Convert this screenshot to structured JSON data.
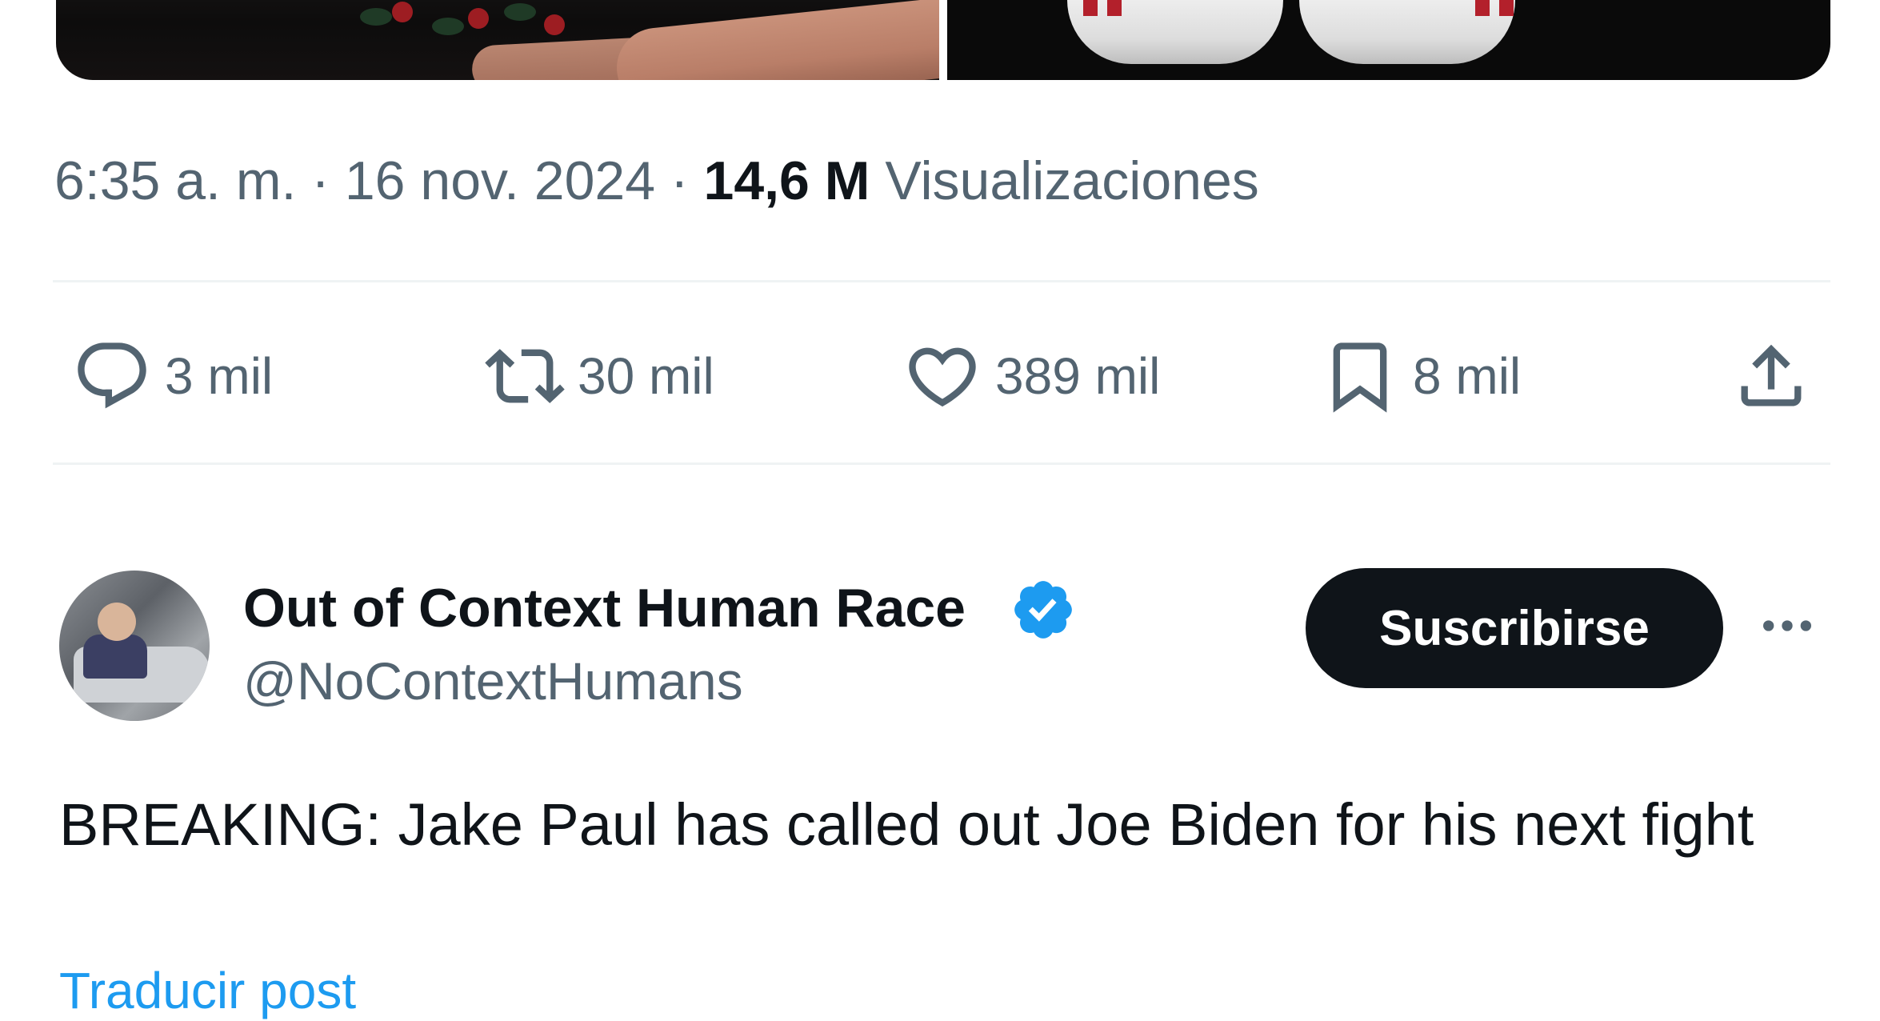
{
  "media": {
    "left_image": "image-photo-hands",
    "right_image": "image-photo-gloves"
  },
  "meta": {
    "time": "6:35 a. m.",
    "separator": "·",
    "date": "16 nov. 2024",
    "views_count": "14,6 M",
    "views_label": "Visualizaciones"
  },
  "actions": {
    "replies": {
      "icon": "reply-icon",
      "count": "3 mil"
    },
    "reposts": {
      "icon": "repost-icon",
      "count": "30 mil"
    },
    "likes": {
      "icon": "heart-icon",
      "count": "389 mil"
    },
    "bookmarks": {
      "icon": "bookmark-icon",
      "count": "8 mil"
    },
    "share": {
      "icon": "share-icon"
    }
  },
  "next_tweet": {
    "author_name": "Out of Context Human Race",
    "handle": "@NoContextHumans",
    "verified_icon": "verified-badge-icon",
    "subscribe_label": "Suscribirse",
    "more_icon": "more-options-icon",
    "text": "BREAKING: Jake Paul has called out Joe Biden for his next fight",
    "translate_label": "Traducir post"
  },
  "colors": {
    "text_primary": "#0f1419",
    "text_secondary": "#536471",
    "accent": "#1d9bf0",
    "divider": "#eff3f4",
    "button_bg": "#0f1419"
  }
}
